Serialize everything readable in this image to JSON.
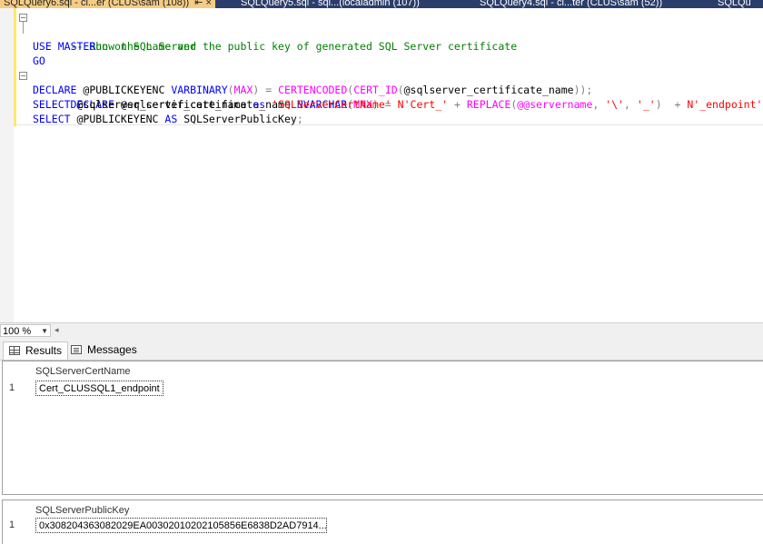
{
  "tabs": [
    {
      "label": "SQLQuery6.sql - cl...er (CLUS\\sam (108))",
      "pin": "⇤ ×",
      "active": true
    },
    {
      "label": "SQLQuery5.sql - sql...(localadmin (107))",
      "active": false
    },
    {
      "label": "SQLQuery4.sql - cl...ter (CLUS\\sam (52))",
      "active": false
    },
    {
      "label": "SQLQu",
      "active": false
    }
  ],
  "editor": {
    "lines": [
      [
        "-- Run on SQL Server"
      ],
      [
        "-- Show the name and the public key of generated SQL Server certificate"
      ],
      [
        "USE",
        " ",
        "MASTER"
      ],
      [
        "GO"
      ],
      [
        "DECLARE",
        " @sqlserver_certificate_name ",
        "NVARCHAR",
        "(",
        "MAX",
        ")",
        " ",
        "=",
        " ",
        "N'Cert_'",
        " ",
        "+",
        " ",
        "REPLACE",
        "(",
        "@@servername",
        ",",
        " ",
        "'\\'",
        ",",
        " ",
        "'_'",
        ")",
        "  ",
        "+",
        " ",
        "N'_endpoint'"
      ],
      [
        "DECLARE",
        " @PUBLICKEYENC ",
        "VARBINARY",
        "(",
        "MAX",
        ")",
        " ",
        "=",
        " ",
        "CERTENCODED",
        "(",
        "CERT_ID",
        "(",
        "@sqlserver_certificate_name",
        "))",
        ";"
      ],
      [
        "SELECT",
        " @sqlserver_certificate_name ",
        "as",
        " ",
        "'SQLServerCertName'"
      ],
      [
        "SELECT",
        " @PUBLICKEYENC ",
        "AS",
        " SQLServerPublicKey",
        ";"
      ]
    ]
  },
  "zoom": {
    "value": "100 %"
  },
  "result_tabs": {
    "results": "Results",
    "messages": "Messages"
  },
  "grid1": {
    "header": "SQLServerCertName",
    "row_number": "1",
    "value": "Cert_CLUSSQL1_endpoint"
  },
  "grid2": {
    "header": "SQLServerPublicKey",
    "row_number": "1",
    "value": "0x308204363082029EA00302010202105856E6838D2AD7914..."
  }
}
